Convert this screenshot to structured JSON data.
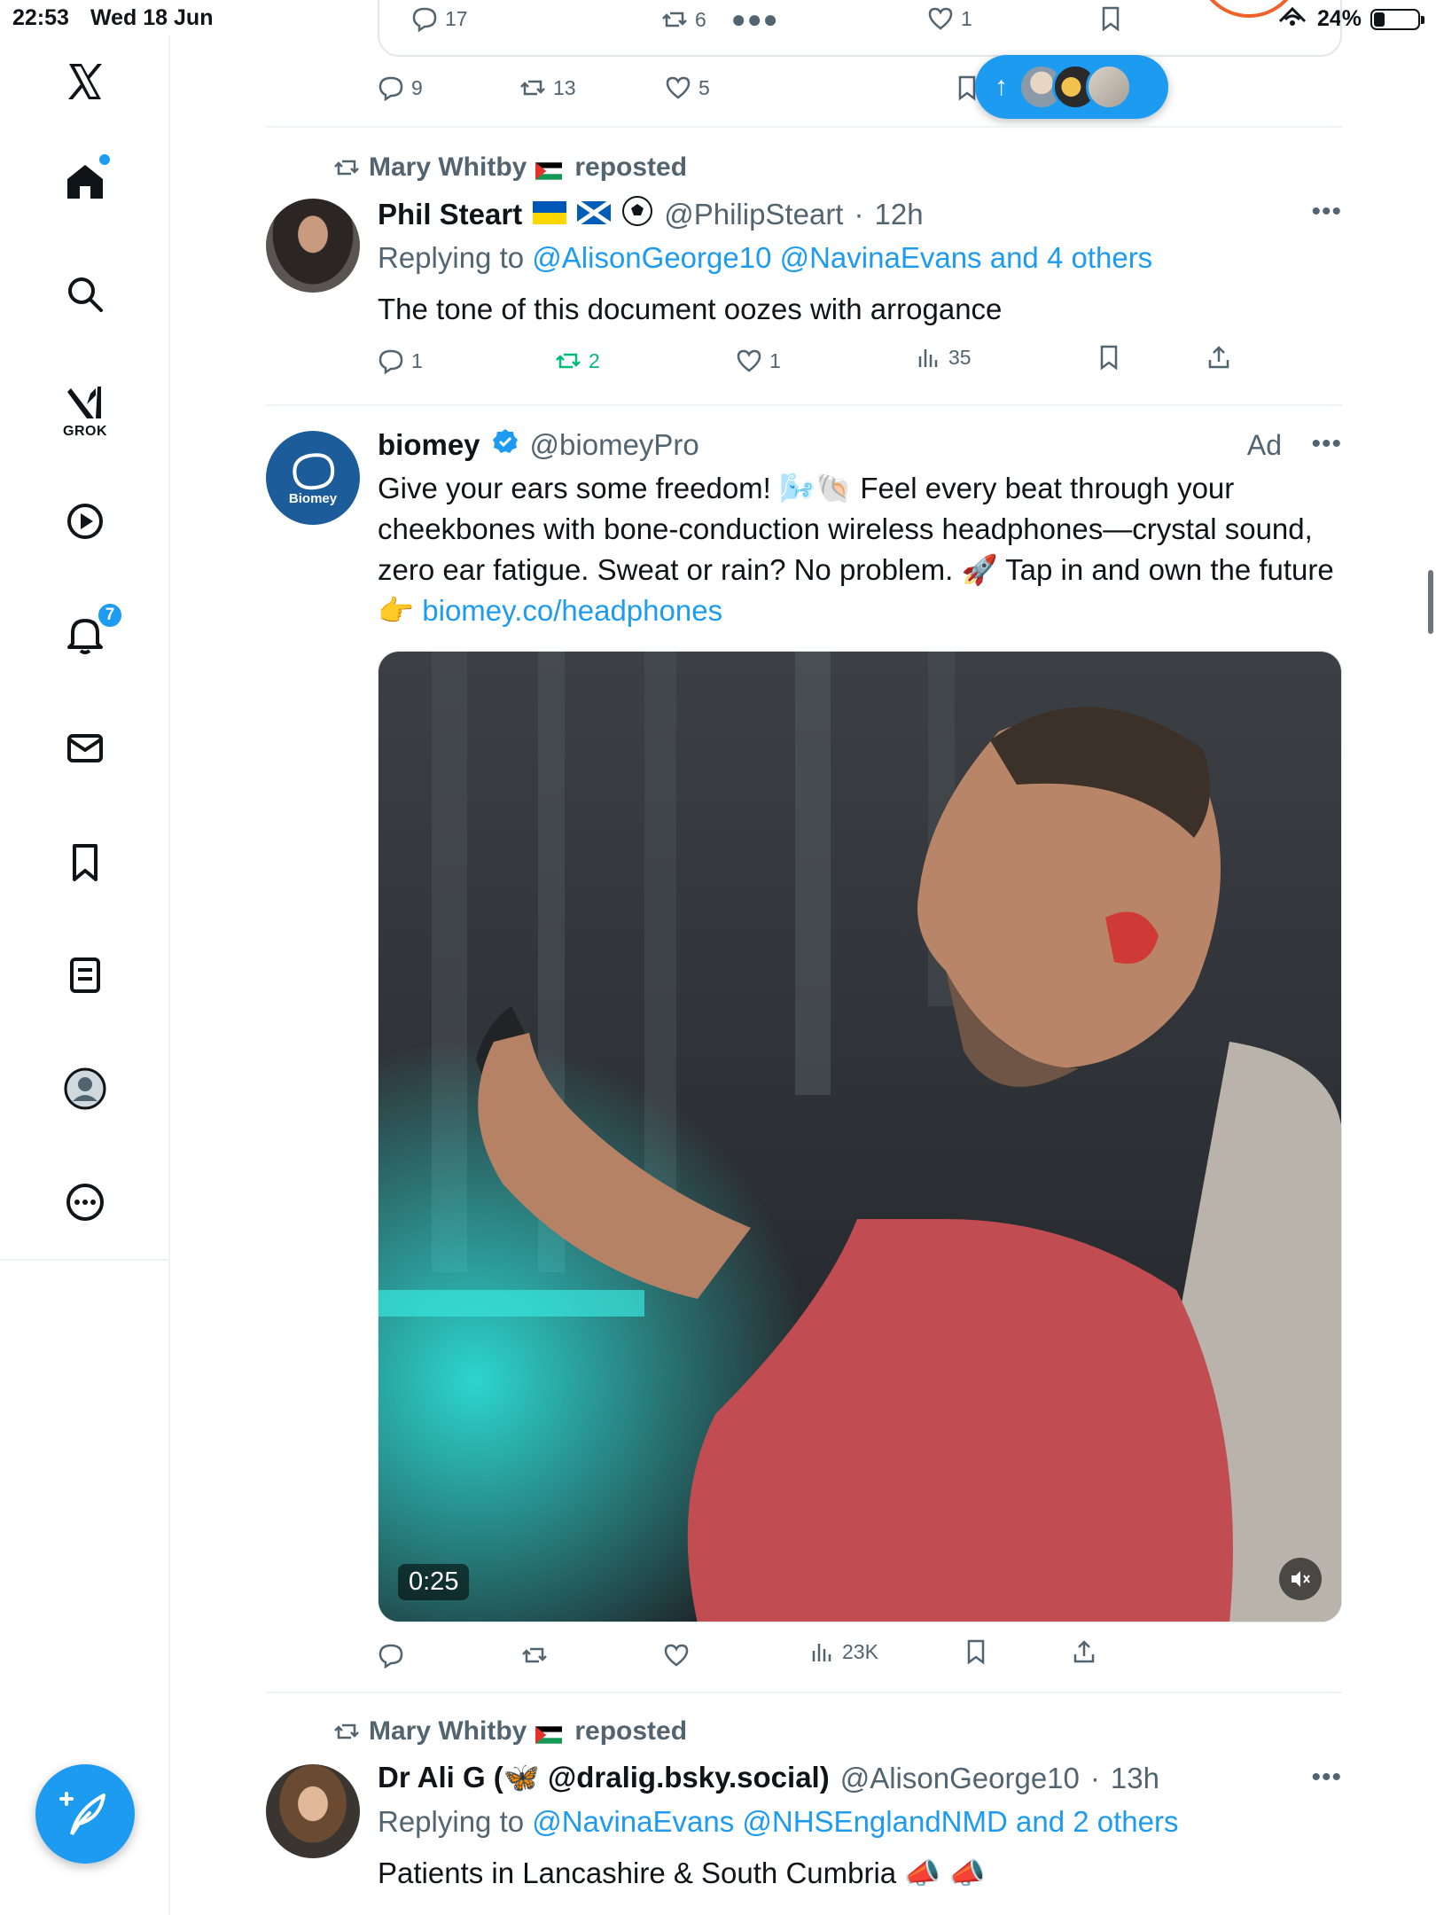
{
  "status_bar": {
    "time": "22:53",
    "date": "Wed 18 Jun",
    "battery": "24%",
    "battery_level": 0.24
  },
  "sidebar": {
    "logo_icon": "x-logo-icon",
    "grok_label": "GROK",
    "notifications_badge": "7",
    "items": [
      "home-icon",
      "search-icon",
      "grok-icon",
      "video-icon",
      "notifications-icon",
      "messages-icon",
      "bookmarks-icon",
      "lists-icon",
      "profile-icon",
      "more-icon"
    ],
    "compose_icon": "compose-icon"
  },
  "top_card": {
    "replies": "17",
    "reposts": "6",
    "likes": "1"
  },
  "post0": {
    "replies": "9",
    "reposts": "13",
    "likes": "5"
  },
  "post1": {
    "repost_by": "Mary Whitby",
    "reposted_label": "reposted",
    "name": "Phil Steart",
    "handle": "@PhilipSteart",
    "time": "12h",
    "replying_to_label": "Replying to",
    "replying_to": "@AlisonGeorge10 @NavinaEvans and 4 others",
    "text": "The tone of this document oozes with arrogance",
    "replies": "1",
    "reposts": "2",
    "likes": "1",
    "views": "35"
  },
  "post2": {
    "name": "biomey",
    "handle": "@biomeyPro",
    "ad_label": "Ad",
    "avatar_text": "Biomey",
    "text_main": "Give your ears some freedom! 🌬️🐚 Feel every beat through your cheekbones with bone-conduction wireless headphones—crystal sound, zero ear fatigue. Sweat or rain? No problem. 🚀 Tap in and own the future 👉",
    "link": "biomey.co/headphones",
    "video_duration": "0:25",
    "views": "23K"
  },
  "post3": {
    "repost_by": "Mary Whitby",
    "reposted_label": "reposted",
    "name": "Dr Ali G (🦋 @dralig.bsky.social)",
    "handle": "@AlisonGeorge10",
    "time": "13h",
    "replying_to_label": "Replying to",
    "replying_to": "@NavinaEvans @NHSEnglandNMD and 2 others",
    "text": "Patients in Lancashire & South Cumbria 📣 📣"
  },
  "colors": {
    "accent": "#1d9bf0",
    "repost_green": "#00ba7c",
    "annotation_orange": "#f0612a",
    "muted": "#536471"
  }
}
